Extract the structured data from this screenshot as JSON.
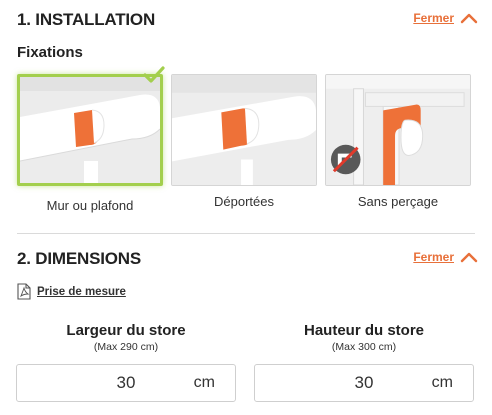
{
  "installation": {
    "title": "1. INSTALLATION",
    "close_label": "Fermer",
    "subtitle": "Fixations",
    "options": [
      {
        "label": "Mur ou plafond",
        "selected": true
      },
      {
        "label": "Déportées",
        "selected": false
      },
      {
        "label": "Sans perçage",
        "selected": false
      }
    ]
  },
  "dimensions": {
    "title": "2. DIMENSIONS",
    "close_label": "Fermer",
    "measure_link": "Prise de mesure",
    "width": {
      "label": "Largeur du store",
      "max": "(Max 290 cm)",
      "value": "30",
      "unit": "cm"
    },
    "height": {
      "label": "Hauteur du store",
      "max": "(Max 300 cm)",
      "value": "30",
      "unit": "cm"
    }
  },
  "colors": {
    "accent": "#e8703a",
    "selected_border": "#a3cf4d"
  },
  "icons": [
    "chevron-up-icon",
    "checkmark-icon",
    "pdf-icon",
    "no-drill-icon"
  ]
}
